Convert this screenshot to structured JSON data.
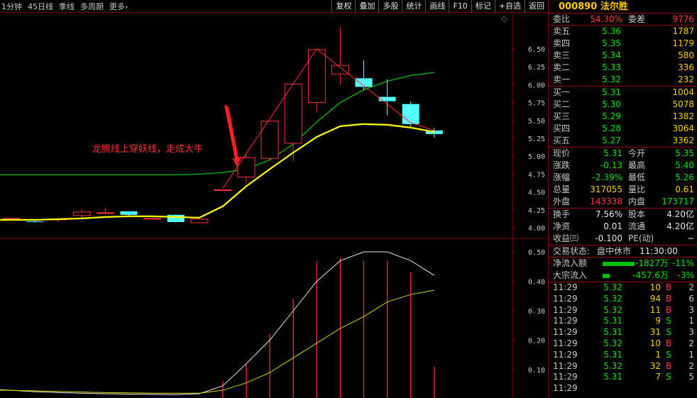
{
  "toolbar": {
    "period_tabs": [
      "1分钟",
      "45日线",
      "季线",
      "多周期",
      "更多›"
    ],
    "buttons": [
      "复权",
      "叠加",
      "多股",
      "统计",
      "画线",
      "F10",
      "标记",
      "+自选",
      "返回"
    ]
  },
  "chart": {
    "annotation": "龙腾线上穿妖线，走成大牛",
    "price_axis": [
      "6.50",
      "6.25",
      "6.00",
      "5.75",
      "5.50",
      "5.25",
      "5.00",
      "4.75",
      "4.50",
      "4.25",
      "4.00"
    ],
    "indicator_axis": [
      "0.50",
      "0.40",
      "0.30",
      "0.20",
      "0.10"
    ],
    "colors": {
      "up": "#ff3232",
      "down": "#54ffff",
      "ma_fast": "#ffff00",
      "ma_slow": "#00c000",
      "grid": "#7a0000"
    },
    "candles": [
      {
        "o": 4.12,
        "c": 4.13,
        "h": 4.14,
        "l": 4.11
      },
      {
        "o": 4.09,
        "c": 4.08,
        "h": 4.1,
        "l": 4.07
      },
      {
        "o": 4.11,
        "c": 4.12,
        "h": 4.13,
        "l": 4.08
      },
      {
        "o": 4.17,
        "c": 4.22,
        "h": 4.26,
        "l": 4.14
      },
      {
        "o": 4.2,
        "c": 4.21,
        "h": 4.27,
        "l": 4.19
      },
      {
        "o": 4.23,
        "c": 4.18,
        "h": 4.23,
        "l": 4.17
      },
      {
        "o": 4.13,
        "c": 4.13,
        "h": 4.14,
        "l": 4.12
      },
      {
        "o": 4.18,
        "c": 4.08,
        "h": 4.19,
        "l": 4.07
      },
      {
        "o": 4.07,
        "c": 4.12,
        "h": 4.13,
        "l": 4.06
      },
      {
        "o": 4.53,
        "c": 4.53,
        "h": 4.53,
        "l": 4.52
      },
      {
        "o": 4.71,
        "c": 4.98,
        "h": 5.02,
        "l": 4.62
      },
      {
        "o": 4.97,
        "c": 5.49,
        "h": 5.49,
        "l": 4.95
      },
      {
        "o": 5.18,
        "c": 6.01,
        "h": 6.01,
        "l": 4.93
      },
      {
        "o": 5.75,
        "c": 6.49,
        "h": 6.49,
        "l": 5.62
      },
      {
        "o": 6.15,
        "c": 6.27,
        "h": 6.8,
        "l": 6.0
      },
      {
        "o": 6.09,
        "c": 5.97,
        "h": 6.34,
        "l": 5.92
      },
      {
        "o": 5.83,
        "c": 5.77,
        "h": 6.08,
        "l": 5.57
      },
      {
        "o": 5.73,
        "c": 5.45,
        "h": 5.77,
        "l": 5.41
      },
      {
        "o": 5.36,
        "c": 5.31,
        "h": 5.4,
        "l": 5.26
      }
    ],
    "ma_fast": [
      4.11,
      4.11,
      4.12,
      4.13,
      4.15,
      4.16,
      4.16,
      4.15,
      4.14,
      4.3,
      4.58,
      4.82,
      5.05,
      5.27,
      5.42,
      5.45,
      5.44,
      5.4,
      5.34
    ],
    "ma_slow": [
      4.74,
      4.74,
      4.74,
      4.74,
      4.74,
      4.74,
      4.74,
      4.74,
      4.75,
      4.77,
      4.82,
      4.95,
      5.17,
      5.48,
      5.75,
      5.93,
      6.05,
      6.13,
      6.17
    ],
    "indicator_white": [
      0.032,
      0.025,
      0.022,
      0.02,
      0.018,
      0.017,
      0.016,
      0.015,
      0.018,
      0.045,
      0.12,
      0.2,
      0.3,
      0.4,
      0.47,
      0.5,
      0.5,
      0.47,
      0.42
    ],
    "indicator_yellow": [
      0.03,
      0.028,
      0.026,
      0.024,
      0.022,
      0.021,
      0.02,
      0.02,
      0.02,
      0.03,
      0.055,
      0.09,
      0.14,
      0.19,
      0.24,
      0.28,
      0.33,
      0.355,
      0.37
    ],
    "indicator_volume": [
      0,
      0,
      0,
      0,
      0,
      0,
      0,
      0,
      0,
      0.06,
      0.12,
      0.22,
      0.34,
      0.47,
      0.48,
      0.47,
      0.47,
      0.43,
      0.11
    ]
  },
  "panel": {
    "code": "000890",
    "name": "法尔胜",
    "weibi_label": "委比",
    "weibi": "54.30%",
    "weicha_label": "委差",
    "weicha": "9776",
    "asks": [
      {
        "name": "卖五",
        "price": "5.36",
        "vol": "1787"
      },
      {
        "name": "卖四",
        "price": "5.35",
        "vol": "1179"
      },
      {
        "name": "卖三",
        "price": "5.34",
        "vol": "580"
      },
      {
        "name": "卖二",
        "price": "5.33",
        "vol": "336"
      },
      {
        "name": "卖一",
        "price": "5.32",
        "vol": "232"
      }
    ],
    "bids": [
      {
        "name": "买一",
        "price": "5.31",
        "vol": "1004"
      },
      {
        "name": "买二",
        "price": "5.30",
        "vol": "5078"
      },
      {
        "name": "买三",
        "price": "5.29",
        "vol": "1382"
      },
      {
        "name": "买四",
        "price": "5.28",
        "vol": "3064"
      },
      {
        "name": "买五",
        "price": "5.27",
        "vol": "3362"
      }
    ],
    "quote": [
      {
        "l1": "现价",
        "v1": "5.31",
        "c1": "green",
        "l2": "今开",
        "v2": "5.35",
        "c2": "green"
      },
      {
        "l1": "涨跌",
        "v1": "-0.13",
        "c1": "green",
        "l2": "最高",
        "v2": "5.40",
        "c2": "green"
      },
      {
        "l1": "涨幅",
        "v1": "-2.39%",
        "c1": "green",
        "l2": "最低",
        "v2": "5.26",
        "c2": "green"
      },
      {
        "l1": "总量",
        "v1": "317055",
        "c1": "yellow",
        "l2": "量比",
        "v2": "0.61",
        "c2": "yellow"
      },
      {
        "l1": "外盘",
        "v1": "143338",
        "c1": "red",
        "l2": "内盘",
        "v2": "173717",
        "c2": "green"
      }
    ],
    "fund": [
      {
        "l1": "换手",
        "v1": "7.56%",
        "l2": "股本",
        "v2": "4.20亿"
      },
      {
        "l1": "净资",
        "v1": "0.01",
        "l2": "流通",
        "v2": "4.20亿"
      },
      {
        "l1": "收益㈢",
        "v1": "-0.100",
        "l2": "PE(动)",
        "v2": "−"
      }
    ],
    "trade_status_label": "交易状态:",
    "trade_status": "盘中休市",
    "trade_time": "11:30:00",
    "flows": [
      {
        "name": "净流入额",
        "amount": "-1827万",
        "pct": "-11%",
        "bar": 0.45
      },
      {
        "name": "大宗流入",
        "amount": "-457.6万",
        "pct": "-3%",
        "bar": 0.1
      }
    ],
    "ticks": [
      {
        "time": "11:29",
        "price": "5.32",
        "pc": "green",
        "vol": "10",
        "side": "B",
        "n": "2"
      },
      {
        "time": "11:29",
        "price": "5.32",
        "pc": "green",
        "vol": "94",
        "side": "B",
        "n": "6"
      },
      {
        "time": "11:29",
        "price": "5.32",
        "pc": "green",
        "vol": "11",
        "side": "B",
        "n": "3"
      },
      {
        "time": "11:29",
        "price": "5.31",
        "pc": "green",
        "vol": "9",
        "side": "S",
        "n": "1"
      },
      {
        "time": "11:29",
        "price": "5.31",
        "pc": "green",
        "vol": "31",
        "side": "S",
        "n": "3"
      },
      {
        "time": "11:29",
        "price": "5.32",
        "pc": "green",
        "vol": "10",
        "side": "B",
        "n": "2"
      },
      {
        "time": "11:29",
        "price": "5.31",
        "pc": "green",
        "vol": "1",
        "side": "S",
        "n": "1"
      },
      {
        "time": "11:29",
        "price": "5.32",
        "pc": "green",
        "vol": "32",
        "side": "B",
        "n": "2"
      },
      {
        "time": "11:29",
        "price": "5.31",
        "pc": "green",
        "vol": "7",
        "side": "S",
        "n": "5"
      },
      {
        "time": "11:29",
        "price": "",
        "pc": "green",
        "vol": "",
        "side": "",
        "n": ""
      }
    ]
  }
}
